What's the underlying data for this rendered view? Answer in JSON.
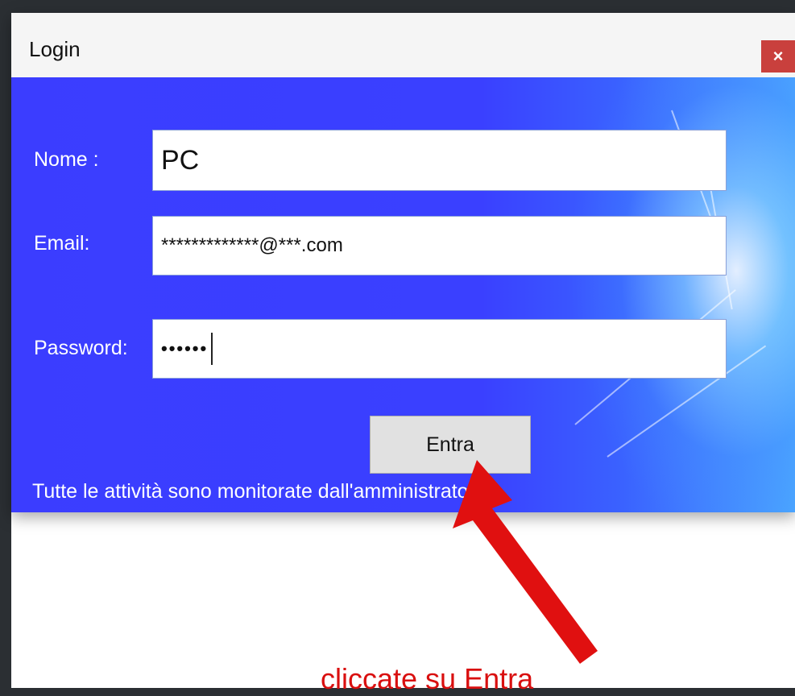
{
  "window": {
    "title": "Login",
    "close_label": "×"
  },
  "form": {
    "nome_label": "Nome :",
    "nome_value": "PC",
    "email_label": "Email:",
    "email_value": "*************@***.com",
    "password_label": "Password:",
    "password_value": "••••••",
    "submit_label": "Entra",
    "notice": "Tutte le attività sono monitorate dall'amministratore."
  },
  "annotation": {
    "text": "cliccate su Entra",
    "color": "#d90f0f"
  },
  "colors": {
    "panel_blue": "#3b3dff",
    "close_red": "#c9403d"
  }
}
